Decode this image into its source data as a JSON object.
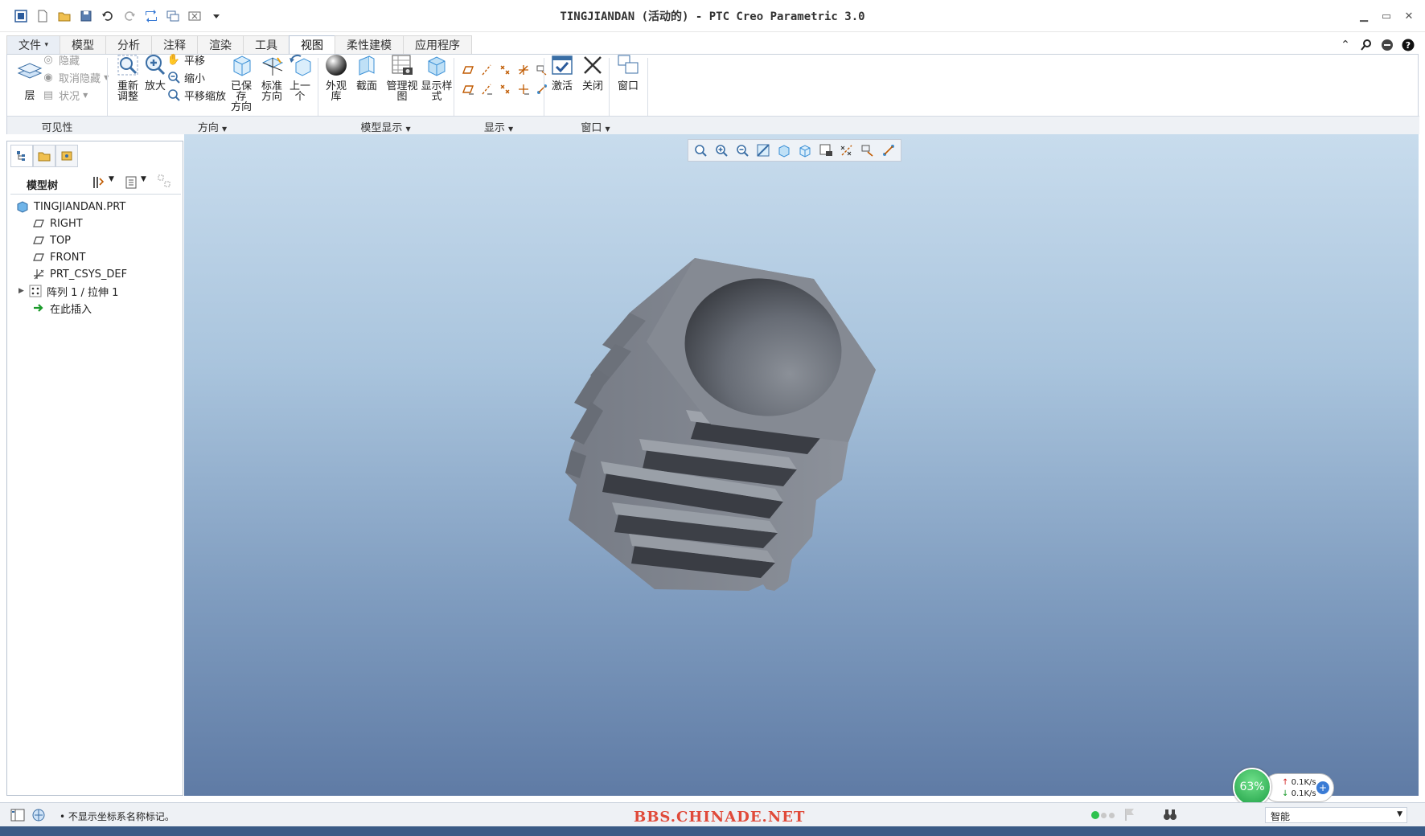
{
  "window": {
    "title": "TINGJIANDAN (活动的) - PTC Creo Parametric 3.0"
  },
  "tabs": [
    {
      "label": "文件"
    },
    {
      "label": "模型"
    },
    {
      "label": "分析"
    },
    {
      "label": "注释"
    },
    {
      "label": "渲染"
    },
    {
      "label": "工具"
    },
    {
      "label": "视图"
    },
    {
      "label": "柔性建模"
    },
    {
      "label": "应用程序"
    }
  ],
  "ribbon": {
    "visibility": {
      "layer": "层",
      "hide": "隐藏",
      "unhide": "取消隐藏",
      "status": "状况",
      "group": "可见性"
    },
    "orientation": {
      "refit_1": "重新",
      "refit_2": "调整",
      "zoom_in": "放大",
      "pan": "平移",
      "zoom_out": "缩小",
      "pan_zoom": "平移缩放",
      "saved_1": "已保存",
      "saved_2": "方向",
      "std_1": "标准",
      "std_2": "方向",
      "prev_1": "上一",
      "prev_2": "个",
      "group": "方向"
    },
    "model_display": {
      "appearance": "外观库",
      "section": "截面",
      "manage_views": "管理视图",
      "style_1": "显示样",
      "style_2": "式",
      "group": "模型显示"
    },
    "show": {
      "group": "显示"
    },
    "window": {
      "activate": "激活",
      "close": "关闭",
      "windows": "窗口",
      "group": "窗口"
    }
  },
  "model_tree": {
    "title": "模型树",
    "items": [
      {
        "label": "TINGJIANDAN.PRT",
        "icon": "part-icon"
      },
      {
        "label": "RIGHT",
        "icon": "datum-plane-icon"
      },
      {
        "label": "TOP",
        "icon": "datum-plane-icon"
      },
      {
        "label": "FRONT",
        "icon": "datum-plane-icon"
      },
      {
        "label": "PRT_CSYS_DEF",
        "icon": "csys-icon"
      },
      {
        "label": "阵列 1 / 拉伸 1",
        "icon": "pattern-icon"
      },
      {
        "label": "在此插入",
        "icon": "insert-here-icon"
      }
    ]
  },
  "network": {
    "percent": "63%",
    "up": "0.1K/s",
    "down": "0.1K/s"
  },
  "status": {
    "message": "• 不显示坐标系名称标记。",
    "watermark": "BBS.CHINADE.NET",
    "filter": "智能"
  },
  "colors": {
    "accent": "#3a6ea5",
    "viewport_top": "#c8dced",
    "viewport_bottom": "#5f7ba5",
    "watermark": "#e04a3a"
  }
}
